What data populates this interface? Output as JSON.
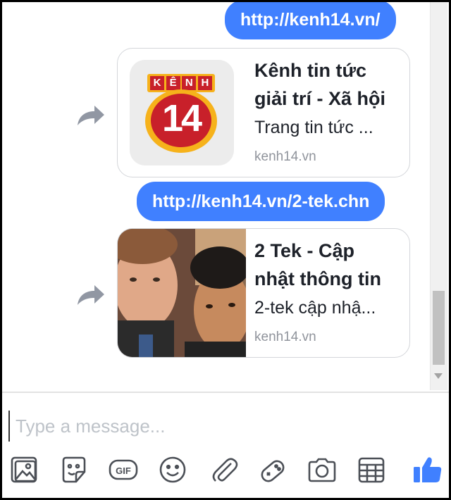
{
  "messages": [
    {
      "type": "sent",
      "text": "http://kenh14.vn/"
    },
    {
      "type": "link_card",
      "logo": {
        "top_letters": [
          "K",
          "Ê",
          "N",
          "H"
        ],
        "number": "14"
      },
      "title_lines": [
        "Kênh tin tức",
        "giải trí - Xã hội"
      ],
      "description": "Trang tin tức ...",
      "domain": "kenh14.vn"
    },
    {
      "type": "sent",
      "text": "http://kenh14.vn/2-tek.chn"
    },
    {
      "type": "link_card",
      "title_lines": [
        "2 Tek - Cập",
        "nhật thông tin"
      ],
      "description": "2-tek cập nhậ...",
      "domain": "kenh14.vn"
    }
  ],
  "composer": {
    "placeholder": "Type a message..."
  },
  "toolbar": [
    "photo-icon",
    "sticker-icon",
    "gif-icon",
    "emoji-icon",
    "attachment-icon",
    "game-icon",
    "camera-icon",
    "table-icon",
    "like-icon"
  ],
  "gif_label": "GIF",
  "colors": {
    "accent": "#4080ff",
    "logo_red": "#c8202a",
    "logo_yellow": "#f6b21b"
  }
}
